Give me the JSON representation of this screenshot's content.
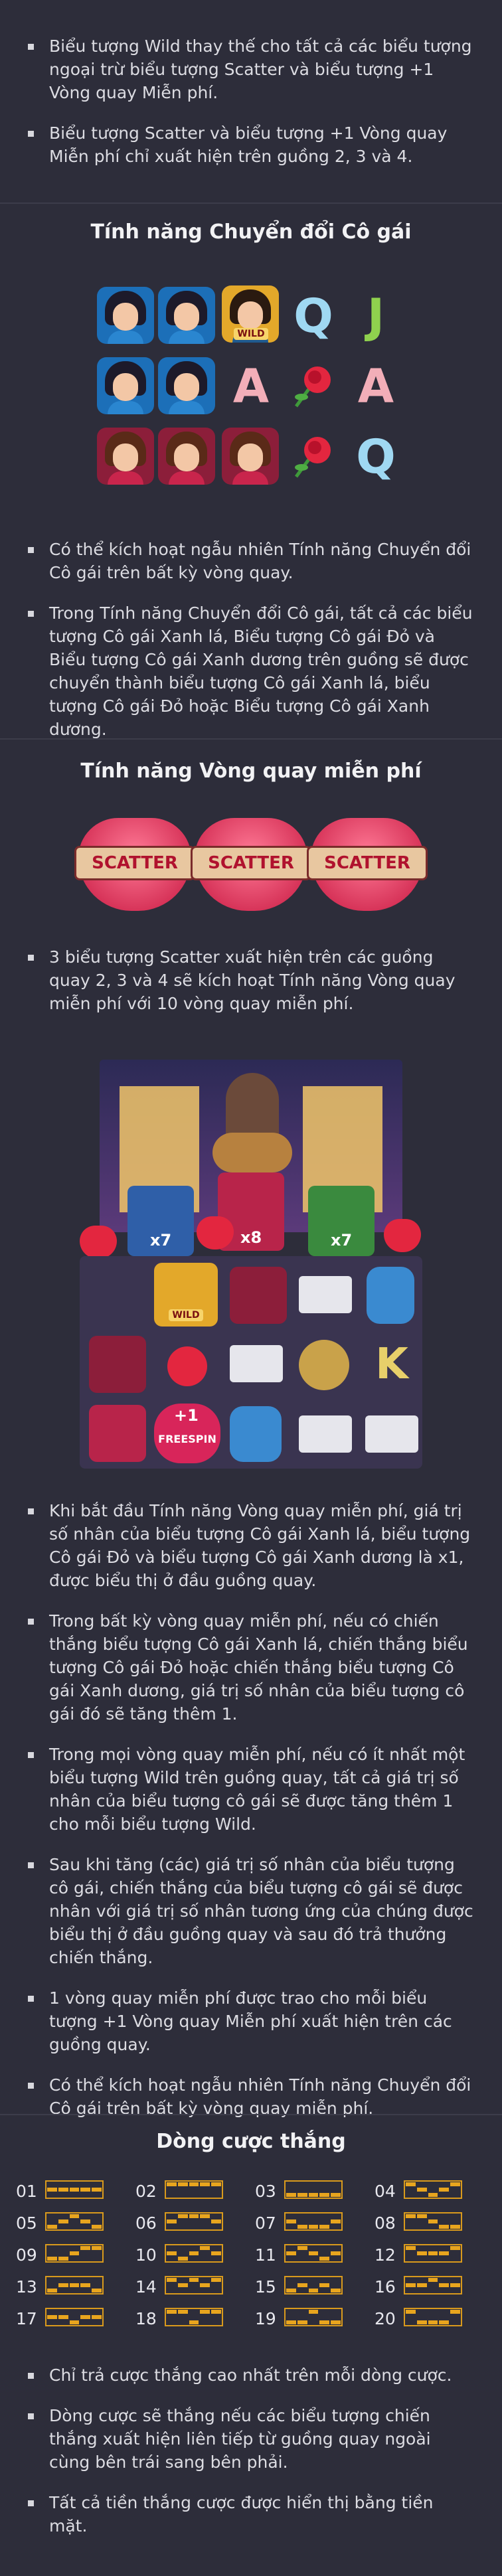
{
  "intro_bullets": [
    "Biểu tượng Wild thay thế cho tất cả các biểu tượng ngoại trừ biểu tượng Scatter và biểu tượng +1 Vòng quay Miễn phí.",
    "Biểu tượng Scatter và biểu tượng +1 Vòng quay Miễn phí chỉ xuất hiện trên guồng 2, 3 và 4."
  ],
  "girl_switch": {
    "title": "Tính năng Chuyển đổi Cô gái",
    "wild_label": "WILD",
    "letters": [
      "Q",
      "J",
      "A",
      "A",
      "Q"
    ],
    "bullets": [
      "Có thể kích hoạt ngẫu nhiên Tính năng Chuyển đổi Cô gái trên bất kỳ vòng quay.",
      "Trong Tính năng Chuyển đổi Cô gái, tất cả các biểu tượng Cô gái Xanh lá, Biểu tượng Cô gái Đỏ và Biểu tượng Cô gái Xanh dương trên guồng sẽ được chuyển thành biểu tượng Cô gái Xanh lá, biểu tượng Cô gái Đỏ hoặc Biểu tượng Cô gái Xanh dương."
    ]
  },
  "free_spins": {
    "title": "Tính năng Vòng quay miễn phí",
    "scatter_label": "SCATTER",
    "bullets_1": [
      "3 biểu tượng Scatter xuất hiện trên các guồng quay 2, 3 và 4 sẽ kích hoạt Tính năng Vòng quay miễn phí với 10 vòng quay miễn phí."
    ],
    "multipliers": [
      "x7",
      "x8",
      "x7"
    ],
    "wild_label": "WILD",
    "freespin_label": "FREESPIN",
    "freespin_plus": "+1",
    "k_letter": "K",
    "bullets_2": [
      "Khi bắt đầu Tính năng Vòng quay miễn phí, giá trị số nhân của biểu tượng Cô gái Xanh lá, biểu tượng Cô gái Đỏ và biểu tượng Cô gái Xanh dương là x1, được biểu thị ở đầu guồng quay.",
      "Trong bất kỳ vòng quay miễn phí, nếu có chiến thắng biểu tượng Cô gái Xanh lá, chiến thắng biểu tượng Cô gái Đỏ hoặc chiến thắng biểu tượng Cô gái Xanh dương, giá trị số nhân của biểu tượng cô gái đó sẽ tăng thêm 1.",
      "Trong mọi vòng quay miễn phí, nếu có ít nhất một biểu tượng Wild trên guồng quay, tất cả giá trị số nhân của biểu tượng cô gái sẽ được tăng thêm 1 cho mỗi biểu tượng Wild.",
      "Sau khi tăng (các) giá trị số nhân của biểu tượng cô gái, chiến thắng của biểu tượng cô gái sẽ được nhân với giá trị số nhân tương ứng của chúng được biểu thị ở đầu guồng quay và sau đó trả thưởng chiến thắng.",
      "1 vòng quay miễn phí được trao cho mỗi biểu tượng +1 Vòng quay Miễn phí xuất hiện trên các guồng quay.",
      "Có thể kích hoạt ngẫu nhiên Tính năng Chuyển đổi Cô gái trên bất kỳ vòng quay miễn phí."
    ]
  },
  "paylines": {
    "title": "Dòng cược thắng",
    "lines": [
      "01",
      "02",
      "03",
      "04",
      "05",
      "06",
      "07",
      "08",
      "09",
      "10",
      "11",
      "12",
      "13",
      "14",
      "15",
      "16",
      "17",
      "18",
      "19",
      "20"
    ],
    "bullets": [
      "Chỉ trả cược thắng cao nhất trên mỗi dòng cược.",
      "Dòng cược sẽ thắng nếu các biểu tượng chiến thắng xuất hiện liên tiếp từ guồng quay ngoài cùng bên trái sang bên phải.",
      "Tất cả tiền thắng cược được hiển thị bằng tiền mặt."
    ]
  }
}
